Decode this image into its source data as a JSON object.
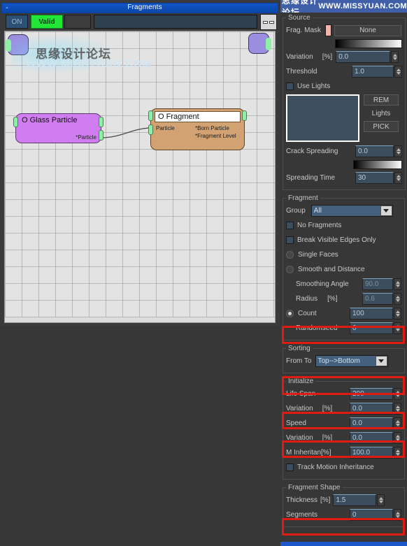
{
  "editor": {
    "title": "Fragments",
    "minimize_label": "-",
    "toolbar": {
      "on_label": "ON",
      "valid_label": "Valid",
      "misc_label": "",
      "field_value": "",
      "dash_button": "window-icon"
    },
    "watermark_cn": "思缘设计论坛",
    "watermark_url": "WWW.MISSYUAN.COM",
    "nodes": [
      {
        "id": "glass-particle",
        "title": "O Glass Particle",
        "outputs": [
          "*Particle"
        ]
      },
      {
        "id": "fragment",
        "title": "O Fragment",
        "inputs": [
          "Particle"
        ],
        "outputs": [
          "*Born Particle",
          "*Fragment Level"
        ]
      }
    ]
  },
  "panel": {
    "header_cn": "思缘设计论坛",
    "header_url": "WWW.MISSYUAN.COM",
    "source": {
      "legend": "Source",
      "frag_mask_label": "Frag. Mask",
      "frag_mask_value": "None",
      "variation_label": "Variation",
      "variation_unit": "[%]",
      "variation_value": "0.0",
      "threshold_label": "Threshold",
      "threshold_value": "1.0",
      "use_lights_label": "Use Lights",
      "rem_label": "REM",
      "lights_label": "Lights",
      "pick_label": "PICK",
      "crack_spreading_label": "Crack Spreading",
      "crack_spreading_value": "0.0",
      "spreading_time_label": "Spreading Time",
      "spreading_time_value": "30"
    },
    "fragment": {
      "legend": "Fragment",
      "group_label": "Group",
      "group_value": "All",
      "no_fragments_label": "No Fragments",
      "break_visible_edges_label": "Break Visible Edges Only",
      "single_faces_label": "Single Faces",
      "smooth_and_distance_label": "Smooth and Distance",
      "smoothing_angle_label": "Smoothing Angle",
      "smoothing_angle_value": "90.0",
      "radius_label": "Radius",
      "radius_unit": "[%]",
      "radius_value": "0.6",
      "count_label": "Count",
      "count_value": "100",
      "randomseed_label": "Randomseed",
      "randomseed_value": "0"
    },
    "sorting": {
      "legend": "Sorting",
      "from_to_label": "From To",
      "from_to_value": "Top-->Bottom"
    },
    "initialize": {
      "legend": "Initialize",
      "life_span_label": "Life Span",
      "life_span_value": "200",
      "variation1_label": "Variation",
      "variation1_unit": "[%]",
      "variation1_value": "0.0",
      "speed_label": "Speed",
      "speed_value": "0.0",
      "variation2_label": "Variation",
      "variation2_unit": "[%]",
      "variation2_value": "0.0",
      "m_inheritan_label": "M Inheritan",
      "m_inheritan_unit": "[%]",
      "m_inheritan_value": "100.0",
      "track_motion_label": "Track Motion Inheritance"
    },
    "fragment_shape": {
      "legend": "Fragment Shape",
      "thickness_label": "Thickness",
      "thickness_unit": "[%]",
      "thickness_value": "1.5",
      "segments_label": "Segments",
      "segments_value": "0"
    }
  },
  "colors": {
    "highlight": "#e01b12",
    "titlebar": "#1255c4",
    "node_glass": "#cf7df0",
    "node_fragment": "#d2a272",
    "valid_green": "#22e635"
  }
}
